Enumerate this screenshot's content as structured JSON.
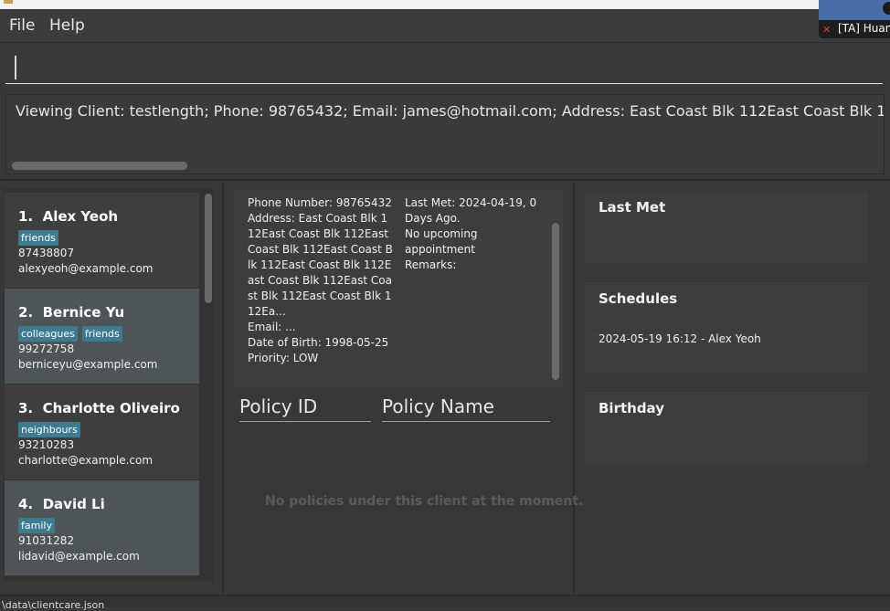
{
  "menu": {
    "file": "File",
    "help": "Help"
  },
  "command": {
    "value": ""
  },
  "result_text": "Viewing Client: testlength; Phone: 98765432; Email: james@hotmail.com; Address: East Coast Blk 112East Coast Blk 112East Coast Blk",
  "clients": [
    {
      "index": "1.",
      "name": "Alex Yeoh",
      "tags": [
        "friends"
      ],
      "phone": "87438807",
      "email": "alexyeoh@example.com"
    },
    {
      "index": "2.",
      "name": "Bernice Yu",
      "tags": [
        "colleagues",
        "friends"
      ],
      "phone": "99272758",
      "email": "berniceyu@example.com"
    },
    {
      "index": "3.",
      "name": "Charlotte Oliveiro",
      "tags": [
        "neighbours"
      ],
      "phone": "93210283",
      "email": "charlotte@example.com"
    },
    {
      "index": "4.",
      "name": "David Li",
      "tags": [
        "family"
      ],
      "phone": "91031282",
      "email": "lidavid@example.com"
    }
  ],
  "detail": {
    "phone": "Phone Number: 98765432",
    "address": "Address: East Coast Blk 112East Coast Blk 112East Coast Blk 112East Coast Blk 112East Coast Blk 112East Coast Blk 112East Coast Blk 112East Coast Blk 112Ea...",
    "email": "Email: ...",
    "dob": "Date of Birth: 1998-05-25",
    "priority": "Priority: LOW",
    "last_met": "Last Met: 2024-04-19, 0 Days Ago.",
    "appointment": "No upcoming appointment",
    "remarks": "Remarks:"
  },
  "policy_table": {
    "col_id": "Policy ID",
    "col_name": "Policy Name",
    "empty": "No policies under this client at the moment."
  },
  "side": {
    "last_met_title": "Last Met",
    "schedules_title": "Schedules",
    "schedule_entry": "2024-05-19 16:12 - Alex Yeoh",
    "birthday_title": "Birthday"
  },
  "status_path": "\\data\\clientcare.json",
  "video_label": "[TA] Huan"
}
